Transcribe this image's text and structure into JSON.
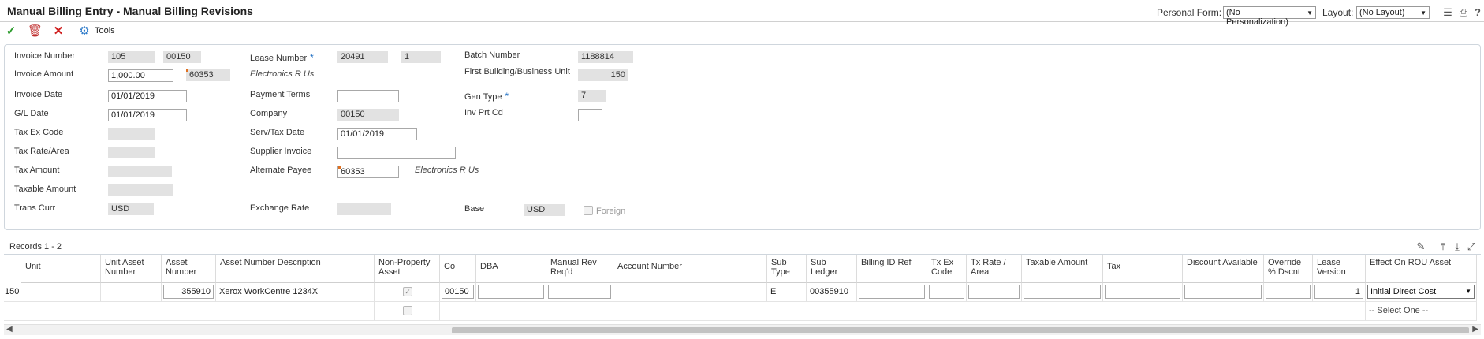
{
  "header": {
    "title": "Manual Billing Entry - Manual Billing Revisions",
    "personal_form_label": "Personal Form:",
    "personal_form_value": "(No Personalization)",
    "layout_label": "Layout:",
    "layout_value": "(No Layout)"
  },
  "toolbar": {
    "tools_label": "Tools"
  },
  "form": {
    "invoice_number_label": "Invoice Number",
    "invoice_number_1": "105",
    "invoice_number_2": "00150",
    "invoice_amount_label": "Invoice Amount",
    "invoice_amount": "1,000.00",
    "invoice_amount_ab": "60353",
    "invoice_date_label": "Invoice Date",
    "invoice_date": "01/01/2019",
    "gl_date_label": "G/L Date",
    "gl_date": "01/01/2019",
    "tax_ex_code_label": "Tax Ex Code",
    "tax_rate_area_label": "Tax Rate/Area",
    "tax_amount_label": "Tax Amount",
    "taxable_amount_label": "Taxable Amount",
    "trans_curr_label": "Trans Curr",
    "trans_curr": "USD",
    "lease_number_label": "Lease Number",
    "lease_number_1": "20491",
    "lease_number_2": "1",
    "electronics_name": "Electronics R Us",
    "payment_terms_label": "Payment Terms",
    "company_label": "Company",
    "company": "00150",
    "serv_tax_date_label": "Serv/Tax Date",
    "serv_tax_date": "01/01/2019",
    "supplier_invoice_label": "Supplier Invoice",
    "alternate_payee_label": "Alternate Payee",
    "alternate_payee": "60353",
    "alternate_payee_name": "Electronics R Us",
    "exchange_rate_label": "Exchange Rate",
    "batch_number_label": "Batch Number",
    "batch_number": "1188814",
    "first_building_label": "First Building/Business Unit",
    "first_building": "150",
    "gen_type_label": "Gen Type",
    "gen_type": "7",
    "inv_prt_cd_label": "Inv Prt Cd",
    "base_label": "Base",
    "base": "USD",
    "foreign_label": "Foreign",
    "required_marker": "*"
  },
  "grid": {
    "records_label": "Records 1 - 2",
    "columns": [
      "Unit",
      "Unit Asset Number",
      "Asset Number",
      "Asset Number Description",
      "Non-Property Asset",
      "Co",
      "DBA",
      "Manual Rev Req'd",
      "Account Number",
      "Sub Type",
      "Sub Ledger",
      "Billing ID Ref",
      "Tx Ex Code",
      "Tx Rate / Area",
      "Taxable Amount",
      "Tax",
      "Discount Available",
      "Override % Dscnt",
      "Lease Version",
      "Effect On ROU Asset"
    ],
    "row1": {
      "unit": "150",
      "asset_number": "355910",
      "asset_desc": "Xerox WorkCentre 1234X",
      "co": "00150",
      "sub_type": "E",
      "sub_ledger": "00355910",
      "lease_version": "1",
      "effect_on_rou": "Initial Direct Cost"
    },
    "row2": {
      "effect_on_rou": "-- Select One --"
    }
  }
}
